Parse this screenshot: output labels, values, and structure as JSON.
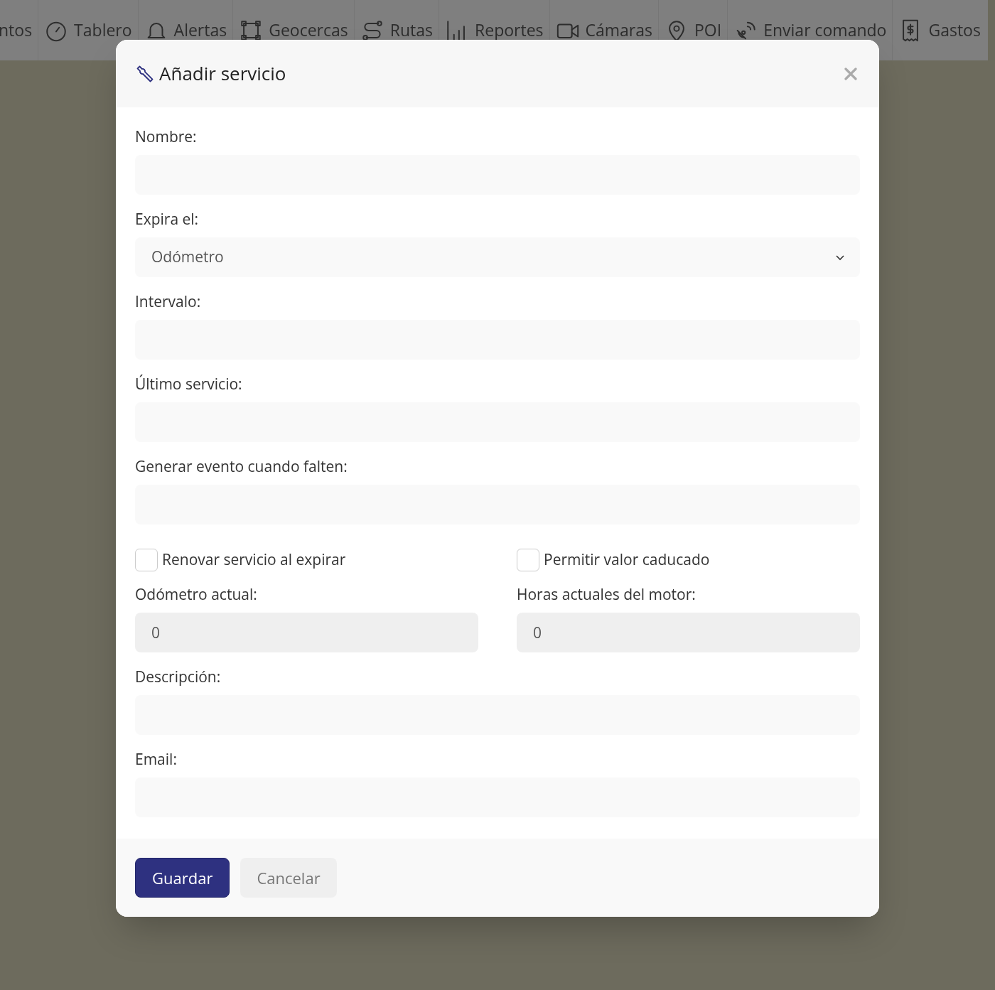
{
  "nav": [
    {
      "label": "ntos",
      "kind": "none"
    },
    {
      "label": "Tablero",
      "kind": "gauge"
    },
    {
      "label": "Alertas",
      "kind": "bell"
    },
    {
      "label": "Geocercas",
      "kind": "geofence"
    },
    {
      "label": "Rutas",
      "kind": "route"
    },
    {
      "label": "Reportes",
      "kind": "chart"
    },
    {
      "label": "Cámaras",
      "kind": "camera"
    },
    {
      "label": "POI",
      "kind": "pin"
    },
    {
      "label": "Enviar comando",
      "kind": "satellite"
    },
    {
      "label": "Gastos",
      "kind": "receipt"
    }
  ],
  "modal": {
    "title": "Añadir servicio",
    "form": [
      {
        "kind": "input",
        "label": "Nombre:"
      },
      {
        "kind": "select",
        "label": "Expira el:",
        "value": "Odómetro"
      },
      {
        "kind": "input",
        "label": "Intervalo:"
      },
      {
        "kind": "input",
        "label": "Último servicio:"
      },
      {
        "kind": "input",
        "label": "Generar evento cuando falten:"
      },
      {
        "kind": "checks",
        "items": [
          {
            "label": "Renovar servicio al expirar",
            "checked": false
          },
          {
            "label": "Permitir valor caducado",
            "checked": false
          }
        ]
      },
      {
        "kind": "pair",
        "items": [
          {
            "label": "Odómetro actual:",
            "value": "0",
            "disabled": true
          },
          {
            "label": "Horas actuales del motor:",
            "value": "0",
            "disabled": true
          }
        ]
      },
      {
        "kind": "input",
        "label": "Descripción:"
      },
      {
        "kind": "input",
        "label": "Email:"
      }
    ],
    "buttons": [
      {
        "label": "Guardar",
        "kind": "primary"
      },
      {
        "label": "Cancelar",
        "kind": "secondary"
      }
    ]
  }
}
